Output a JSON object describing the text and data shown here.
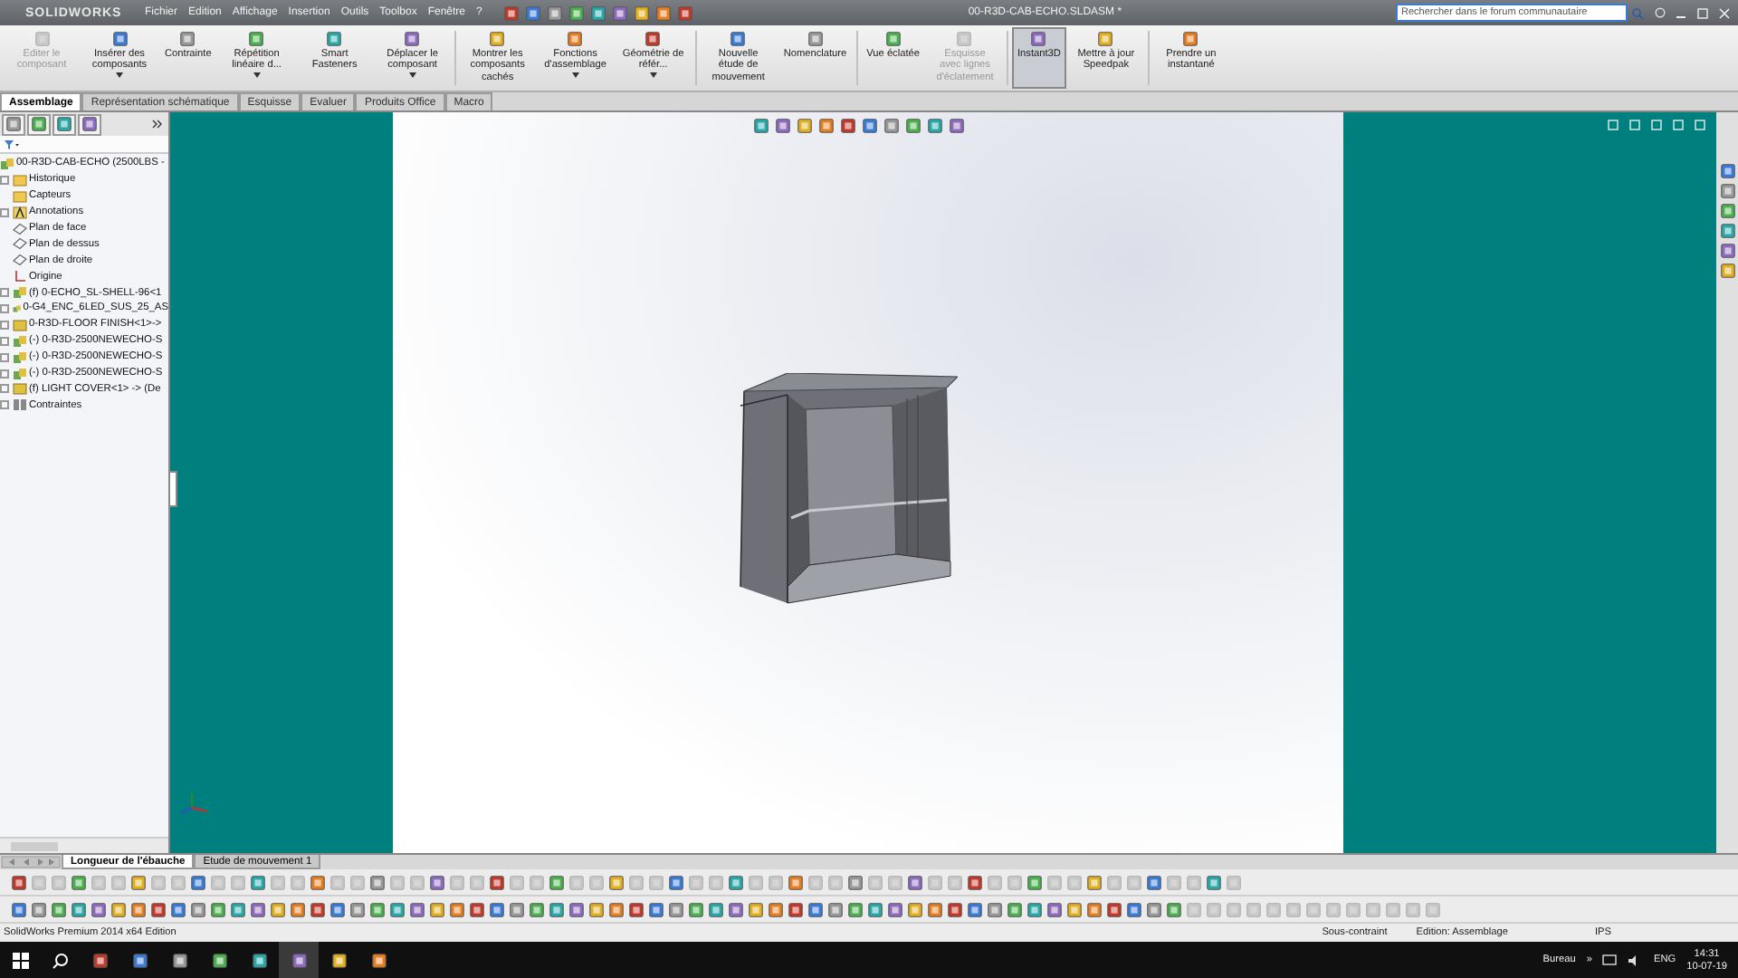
{
  "title_bar": {
    "logo": "SOLIDWORKS",
    "menus": [
      "Fichier",
      "Edition",
      "Affichage",
      "Insertion",
      "Outils",
      "Toolbox",
      "Fenêtre",
      "?"
    ],
    "title": "00-R3D-CAB-ECHO.SLDASM *",
    "search": {
      "placeholder": "Rechercher dans le forum communautaire"
    }
  },
  "ribbon": [
    {
      "label": "Editer le composant",
      "disabled": true,
      "dropdown": false,
      "selected": false
    },
    {
      "label": "Insérer des composants",
      "disabled": false,
      "dropdown": true,
      "selected": false
    },
    {
      "label": "Contrainte",
      "disabled": false,
      "dropdown": false,
      "selected": false
    },
    {
      "label": "Répétition linéaire d...",
      "disabled": false,
      "dropdown": true,
      "selected": false
    },
    {
      "label": "Smart Fasteners",
      "disabled": false,
      "dropdown": false,
      "selected": false
    },
    {
      "label": "Déplacer le composant",
      "disabled": false,
      "dropdown": true,
      "selected": false
    },
    {
      "label": "Montrer les composants cachés",
      "disabled": false,
      "dropdown": false,
      "selected": false
    },
    {
      "label": "Fonctions d'assemblage",
      "disabled": false,
      "dropdown": true,
      "selected": false
    },
    {
      "label": "Géométrie de référ...",
      "disabled": false,
      "dropdown": true,
      "selected": false
    },
    {
      "label": "Nouvelle étude de mouvement",
      "disabled": false,
      "dropdown": false,
      "selected": false
    },
    {
      "label": "Nomenclature",
      "disabled": false,
      "dropdown": false,
      "selected": false
    },
    {
      "label": "Vue éclatée",
      "disabled": false,
      "dropdown": false,
      "selected": false
    },
    {
      "label": "Esquisse avec lignes d'éclatement",
      "disabled": true,
      "dropdown": false,
      "selected": false
    },
    {
      "label": "Instant3D",
      "disabled": false,
      "dropdown": false,
      "selected": true
    },
    {
      "label": "Mettre à jour Speedpak",
      "disabled": false,
      "dropdown": false,
      "selected": false
    },
    {
      "label": "Prendre un instantané",
      "disabled": false,
      "dropdown": false,
      "selected": false
    }
  ],
  "tabs": [
    {
      "label": "Assemblage",
      "selected": true
    },
    {
      "label": "Représentation schématique",
      "selected": false
    },
    {
      "label": "Esquisse",
      "selected": false
    },
    {
      "label": "Evaluer",
      "selected": false
    },
    {
      "label": "Produits Office",
      "selected": false
    },
    {
      "label": "Macro",
      "selected": false
    }
  ],
  "tree": {
    "root": "00-R3D-CAB-ECHO  (2500LBS -",
    "items": [
      {
        "label": "Historique",
        "kind": "folder",
        "expandable": true
      },
      {
        "label": "Capteurs",
        "kind": "folder",
        "expandable": false
      },
      {
        "label": "Annotations",
        "kind": "annotation",
        "expandable": true
      },
      {
        "label": "Plan de face",
        "kind": "plane",
        "expandable": false
      },
      {
        "label": "Plan de dessus",
        "kind": "plane",
        "expandable": false
      },
      {
        "label": "Plan de droite",
        "kind": "plane",
        "expandable": false
      },
      {
        "label": "Origine",
        "kind": "origin",
        "expandable": false
      },
      {
        "label": "(f) 0-ECHO_SL-SHELL-96<1",
        "kind": "assembly",
        "expandable": true
      },
      {
        "label": "0-G4_ENC_6LED_SUS_25_AS",
        "kind": "assembly",
        "expandable": true
      },
      {
        "label": "0-R3D-FLOOR FINISH<1>->",
        "kind": "part",
        "expandable": true
      },
      {
        "label": "(-) 0-R3D-2500NEWECHO-S",
        "kind": "assembly",
        "expandable": true
      },
      {
        "label": "(-) 0-R3D-2500NEWECHO-S",
        "kind": "assembly",
        "expandable": true
      },
      {
        "label": "(-) 0-R3D-2500NEWECHO-S",
        "kind": "assembly",
        "expandable": true
      },
      {
        "label": "(f) LIGHT COVER<1> -> (De",
        "kind": "part",
        "expandable": true
      },
      {
        "label": "Contraintes",
        "kind": "mates",
        "expandable": true
      }
    ]
  },
  "bottom_tabs": [
    {
      "label": "Longueur de l'ébauche",
      "selected": true
    },
    {
      "label": "Etude de mouvement 1",
      "selected": false
    }
  ],
  "status_bar": {
    "edition": "SolidWorks Premium 2014 x64 Edition",
    "state": "Sous-contraint",
    "mode": "Edition: Assemblage",
    "units": "IPS"
  },
  "taskbar": {
    "apps": [
      {
        "selected": false
      },
      {
        "selected": false
      },
      {
        "selected": false
      },
      {
        "selected": false
      },
      {
        "selected": false
      },
      {
        "selected": false
      },
      {
        "selected": false
      },
      {
        "selected": true
      },
      {
        "selected": false
      },
      {
        "selected": false
      }
    ],
    "desktop": "Bureau",
    "chevron": "»",
    "language": "ENG",
    "time": "14:31",
    "date": "10-07-19"
  }
}
